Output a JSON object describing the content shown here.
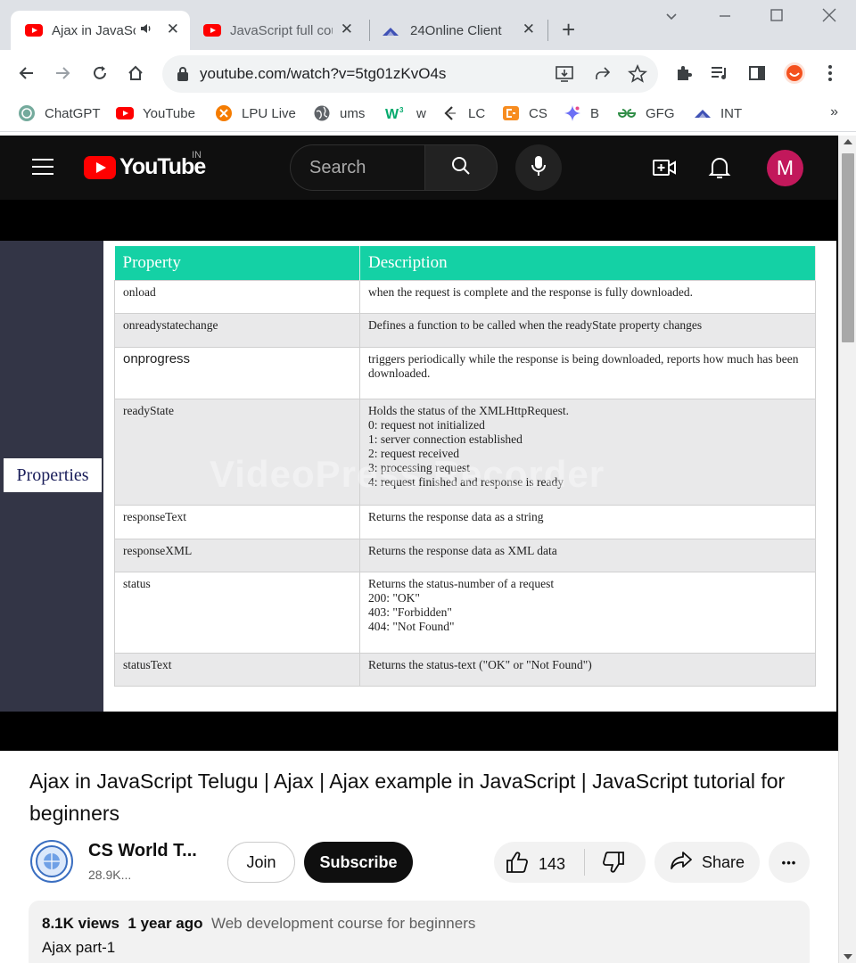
{
  "browser": {
    "tabs": [
      {
        "title": "Ajax in JavaScript Telugu",
        "favicon": "youtube-icon",
        "active": true
      },
      {
        "title": "JavaScript full course",
        "favicon": "youtube-icon",
        "active": false
      },
      {
        "title": "24Online Client",
        "favicon": "24online-icon",
        "active": false
      }
    ],
    "url": "youtube.com/watch?v=5tg01zKvO4s",
    "bookmarks": [
      {
        "label": "ChatGPT",
        "icon": "chatgpt-icon"
      },
      {
        "label": "YouTube",
        "icon": "youtube-icon"
      },
      {
        "label": "LPU Live",
        "icon": "lpu-icon"
      },
      {
        "label": "ums",
        "icon": "globe-icon"
      },
      {
        "label": "w",
        "icon": "w3schools-icon"
      },
      {
        "label": "LC",
        "icon": "leetcode-icon"
      },
      {
        "label": "CS",
        "icon": "codestudio-icon"
      },
      {
        "label": "B",
        "icon": "gemini-icon"
      },
      {
        "label": "GFG",
        "icon": "gfg-icon"
      },
      {
        "label": "INT",
        "icon": "24online-icon"
      }
    ],
    "bookmarks_overflow": "»"
  },
  "youtube": {
    "logo_text": "YouTube",
    "country_code": "IN",
    "search_placeholder": "Search",
    "avatar_letter": "M",
    "colors": {
      "brand": "#ff0000",
      "avatar": "#c2185b",
      "table_header": "#14d1a5"
    }
  },
  "slide": {
    "side_label": "Properties",
    "header": [
      "Property",
      "Description"
    ],
    "rows": [
      {
        "property": "onload",
        "description": "when the request is complete  and the response is fully downloaded."
      },
      {
        "property": "onreadystatechange",
        "description": "Defines a function to be called when the readyState property changes"
      },
      {
        "property": "onprogress",
        "description": "triggers periodically while the response is being downloaded, reports how much has been downloaded."
      },
      {
        "property": "readyState",
        "description": "Holds the status of the XMLHttpRequest.\n0: request not initialized\n1: server connection established\n2: request received\n3: processing request\n4: request finished and response is ready"
      },
      {
        "property": "responseText",
        "description": "Returns the response data as a string"
      },
      {
        "property": "responseXML",
        "description": "Returns the response data as XML data"
      },
      {
        "property": "status",
        "description": "Returns the status-number of a request\n200: \"OK\"\n403: \"Forbidden\"\n404: \"Not Found\""
      },
      {
        "property": "statusText",
        "description": "Returns the status-text (\"OK\" or \"Not Found\")"
      }
    ],
    "watermark": "VideoPress Recorder"
  },
  "video": {
    "title": "Ajax in JavaScript Telugu | Ajax | Ajax example in JavaScript | JavaScript tutorial for beginners",
    "channel_name": "CS World T...",
    "subscribers": "28.9K...",
    "join_label": "Join",
    "subscribe_label": "Subscribe",
    "likes": "143",
    "share_label": "Share",
    "more_label": "•••",
    "views": "8.1K views",
    "uploaded": "1 year ago",
    "playlist": "Web development course for beginners",
    "description_line": "Ajax part-1"
  }
}
